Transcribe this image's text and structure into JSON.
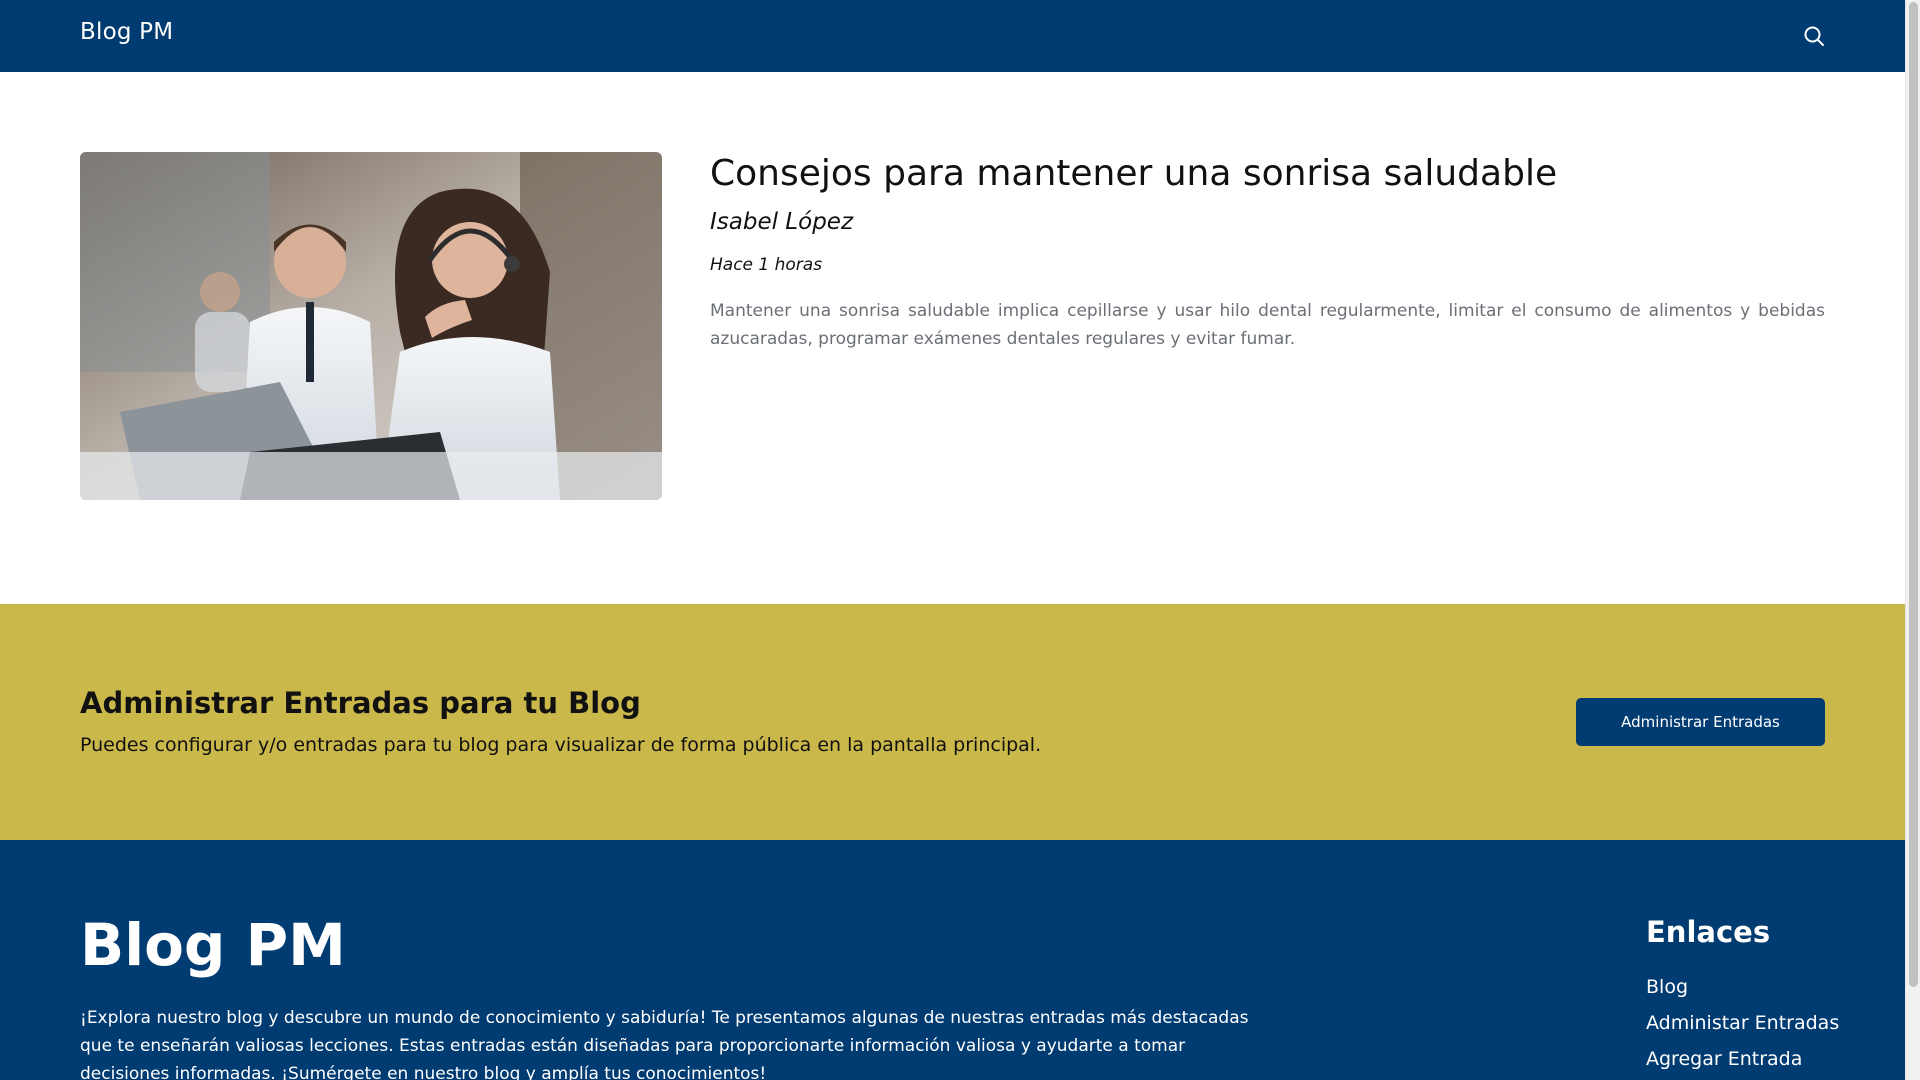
{
  "navbar": {
    "brand": "Blog PM",
    "search_icon": "search-icon"
  },
  "post": {
    "image_alt": "Agentes de atención al cliente con auriculares trabajando en portátiles",
    "title": "Consejos para mantener una sonrisa saludable",
    "author": "Isabel López",
    "time": "Hace 1 horas",
    "excerpt": "Mantener una sonrisa saludable implica cepillarse y usar hilo dental regularmente, limitar el consumo de alimentos y bebidas azucaradas, programar exámenes dentales regulares y evitar fumar."
  },
  "admin": {
    "title": "Administrar Entradas para tu Blog",
    "description": "Puedes configurar y/o entradas para tu blog para visualizar de forma pública en la pantalla principal.",
    "button_label": "Administrar Entradas"
  },
  "footer": {
    "brand": "Blog PM",
    "description": "¡Explora nuestro blog y descubre un mundo de conocimiento y sabiduría! Te presentamos algunas de nuestras entradas más destacadas que te enseñarán valiosas lecciones. Estas entradas están diseñadas para proporcionarte información valiosa y ayudarte a tomar decisiones informadas. ¡Sumérgete en nuestro blog y amplía tus conocimientos!",
    "links_title": "Enlaces",
    "links": [
      {
        "label": "Blog"
      },
      {
        "label": "Administar Entradas"
      },
      {
        "label": "Agregar Entrada"
      }
    ]
  },
  "colors": {
    "primary": "#003b71",
    "accent": "#cbb84b"
  }
}
